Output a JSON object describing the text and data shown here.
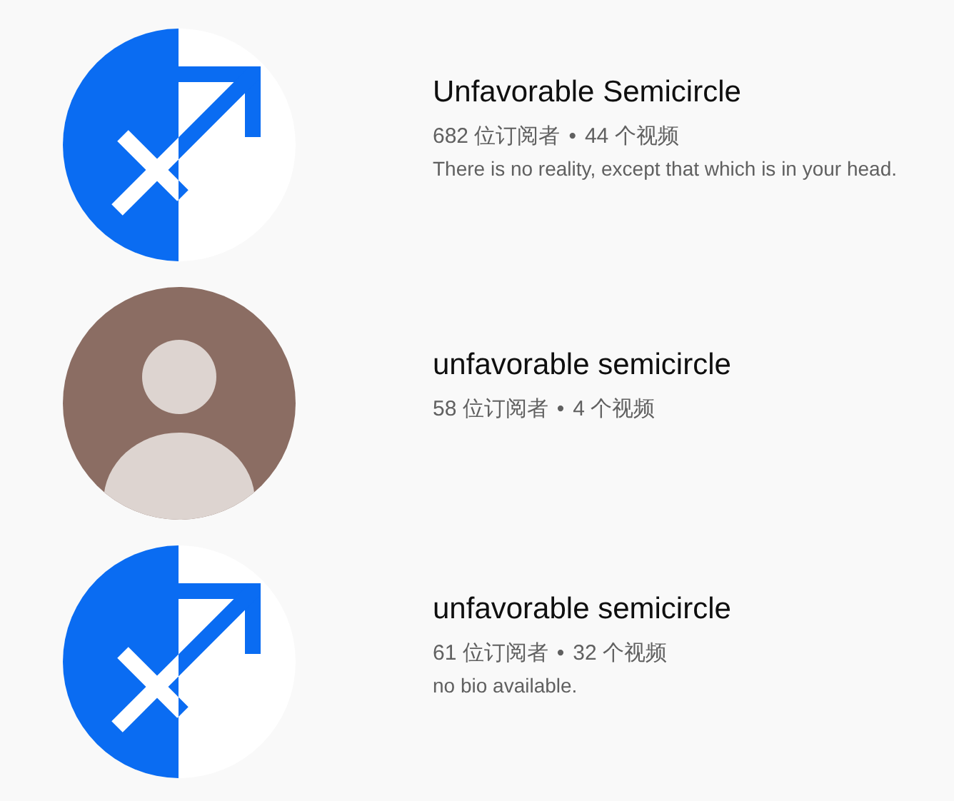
{
  "channels": [
    {
      "avatar": {
        "kind": "sagittarius"
      },
      "name": "Unfavorable Semicircle",
      "subscribers": "682 位订阅者",
      "separator": "•",
      "videos": "44 个视频",
      "description": "There is no reality, except that which is in your head."
    },
    {
      "avatar": {
        "kind": "default"
      },
      "name": "unfavorable semicircle",
      "subscribers": "58 位订阅者",
      "separator": "•",
      "videos": "4 个视频"
    },
    {
      "avatar": {
        "kind": "sagittarius"
      },
      "name": "unfavorable semicircle",
      "subscribers": "61 位订阅者",
      "separator": "•",
      "videos": "32 个视频",
      "description": "no bio available."
    }
  ]
}
